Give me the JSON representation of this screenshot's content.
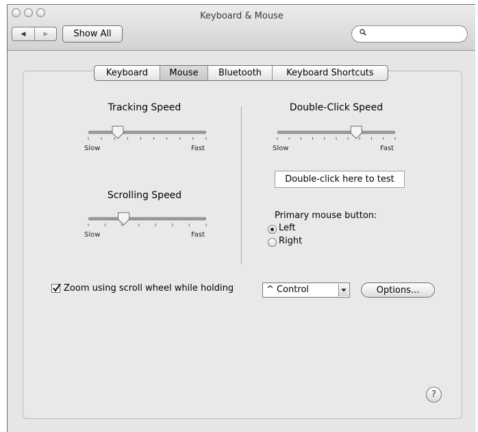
{
  "window": {
    "title": "Keyboard & Mouse"
  },
  "toolbar": {
    "back_icon": "left-triangle-icon",
    "forward_icon": "right-triangle-icon",
    "show_all_label": "Show All",
    "search_placeholder": "",
    "search_icon": "magnifier-icon"
  },
  "tabs": [
    {
      "label": "Keyboard",
      "selected": false
    },
    {
      "label": "Mouse",
      "selected": true
    },
    {
      "label": "Bluetooth",
      "selected": false
    },
    {
      "label": "Keyboard Shortcuts",
      "selected": false
    }
  ],
  "tracking": {
    "label": "Tracking Speed",
    "min_label": "Slow",
    "max_label": "Fast",
    "value": 0.25,
    "ticks": 10
  },
  "scrolling": {
    "label": "Scrolling Speed",
    "min_label": "Slow",
    "max_label": "Fast",
    "value": 0.3,
    "ticks": 8
  },
  "double_click": {
    "label": "Double-Click Speed",
    "min_label": "Slow",
    "max_label": "Fast",
    "value": 0.67,
    "ticks": 11
  },
  "test_area": {
    "label": "Double-click here to test"
  },
  "primary_button": {
    "label": "Primary mouse button:",
    "options": [
      {
        "label": "Left",
        "selected": true
      },
      {
        "label": "Right",
        "selected": false
      }
    ]
  },
  "zoom": {
    "checked": true,
    "label": "Zoom using scroll wheel while holding",
    "modifier": "^ Control",
    "options_label": "Options..."
  },
  "help": {
    "label": "?"
  },
  "colors": {
    "panel": "#e9e9e9",
    "titlebar": "#d3d3d3",
    "border": "#6f6f6f"
  }
}
